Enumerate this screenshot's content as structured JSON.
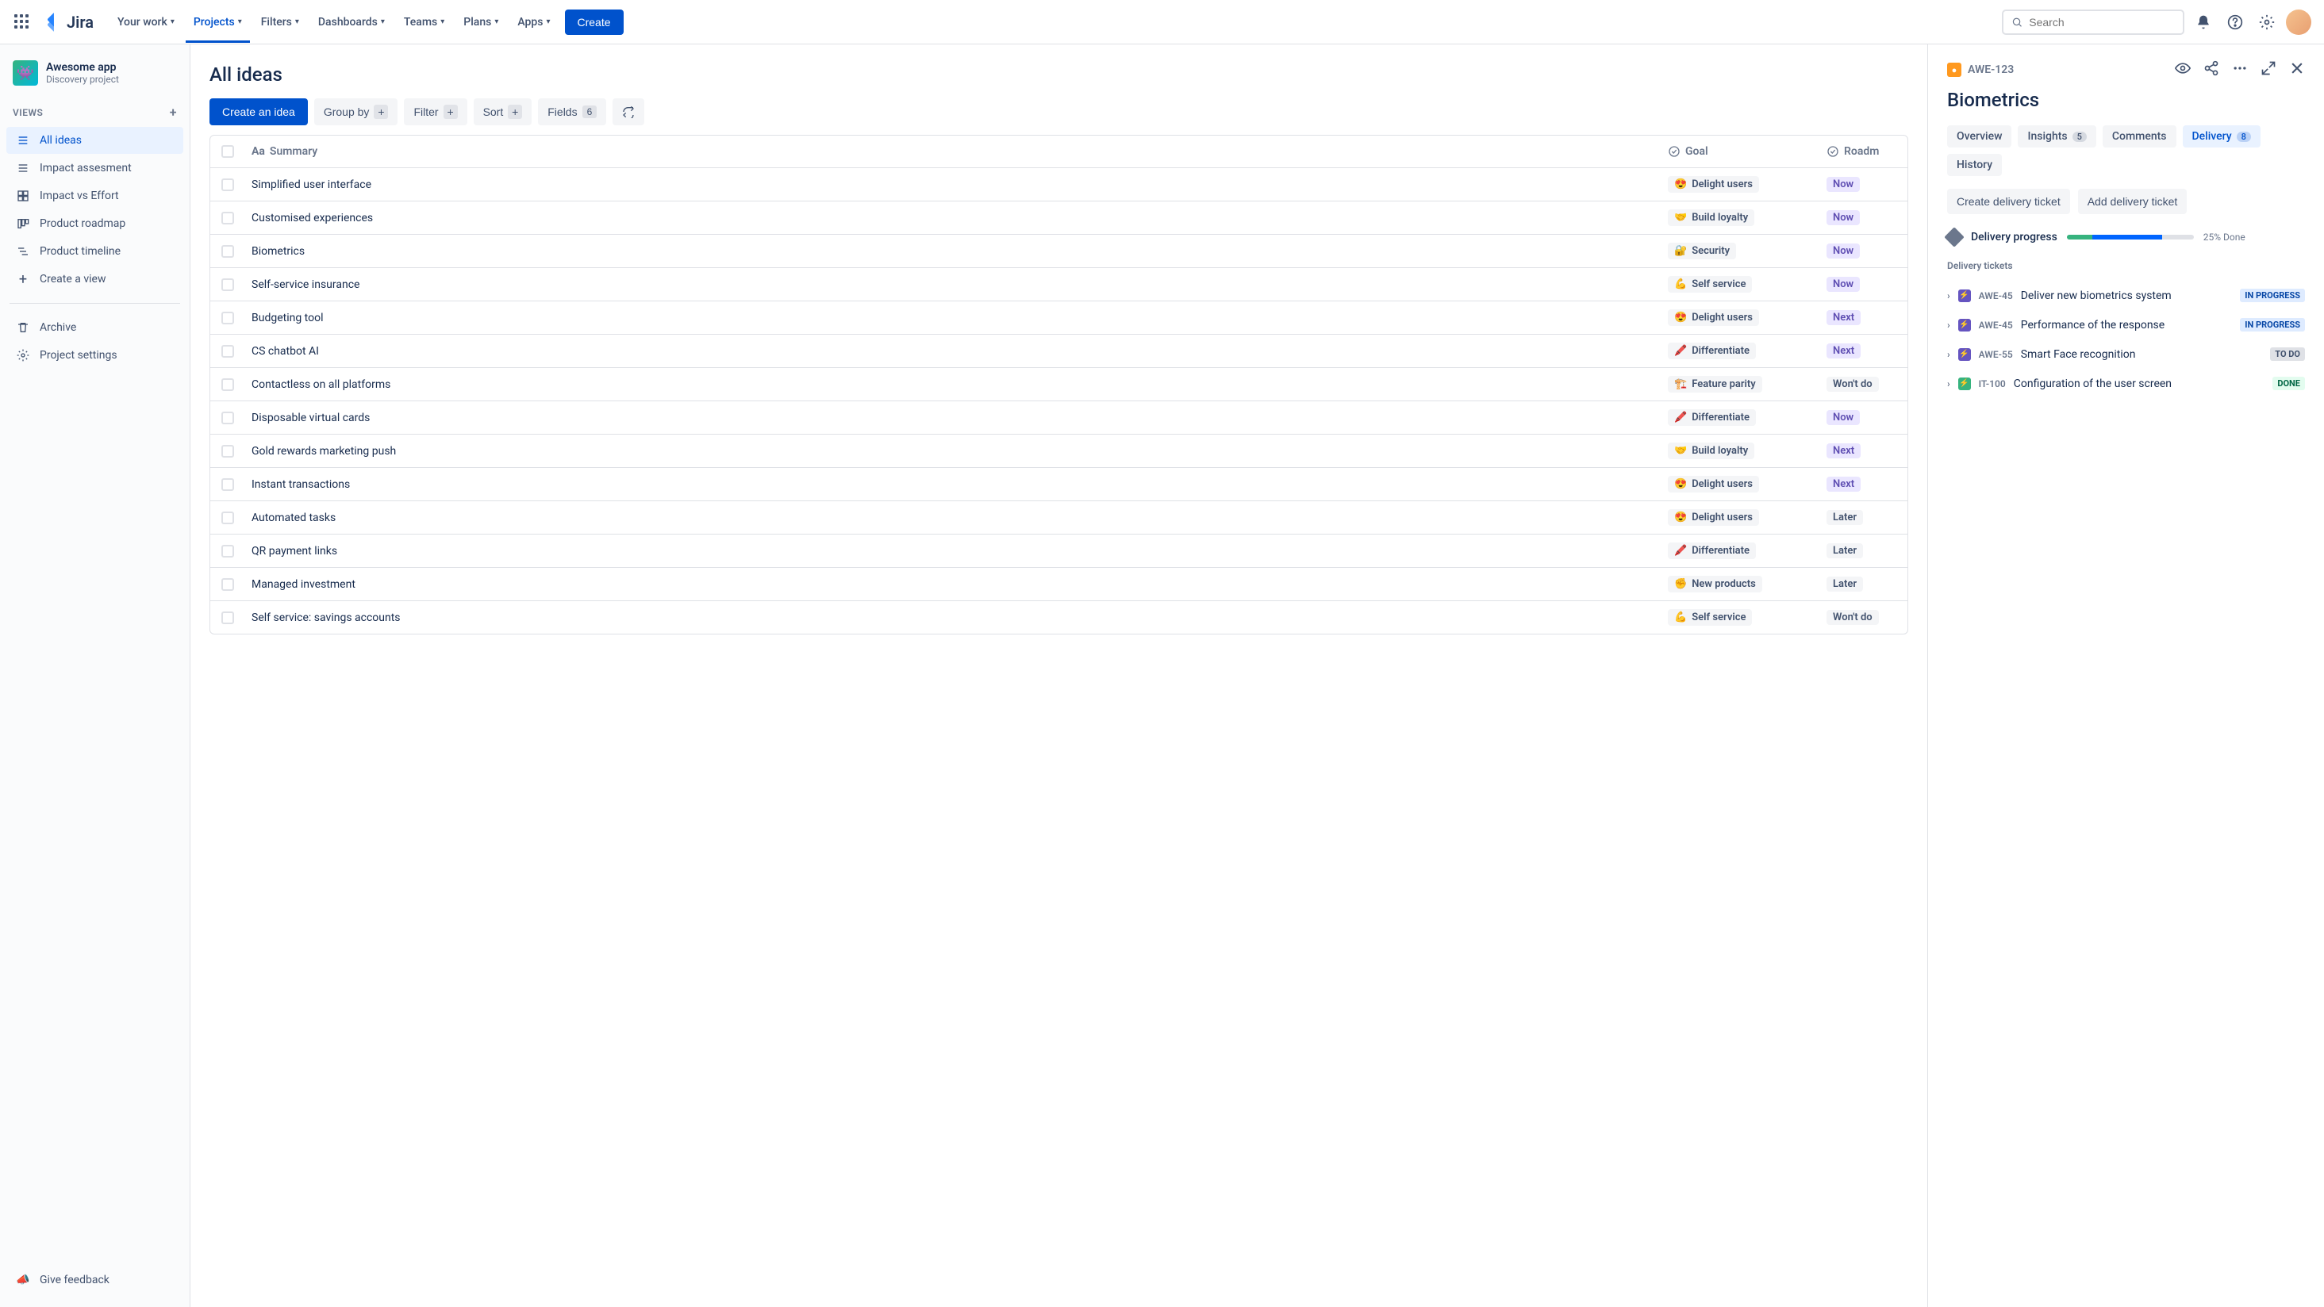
{
  "nav": {
    "logo": "Jira",
    "items": [
      "Your work",
      "Projects",
      "Filters",
      "Dashboards",
      "Teams",
      "Plans",
      "Apps"
    ],
    "activeIndex": 1,
    "createLabel": "Create",
    "searchPlaceholder": "Search"
  },
  "sidebar": {
    "project": {
      "name": "Awesome app",
      "type": "Discovery project"
    },
    "viewsHeader": "VIEWS",
    "views": [
      {
        "label": "All ideas",
        "icon": "list",
        "selected": true
      },
      {
        "label": "Impact assesment",
        "icon": "list"
      },
      {
        "label": "Impact vs Effort",
        "icon": "matrix"
      },
      {
        "label": "Product roadmap",
        "icon": "board"
      },
      {
        "label": "Product timeline",
        "icon": "timeline"
      },
      {
        "label": "Create a view",
        "icon": "plus"
      }
    ],
    "footer": [
      {
        "label": "Archive",
        "icon": "trash"
      },
      {
        "label": "Project settings",
        "icon": "gear"
      }
    ],
    "feedback": "Give feedback"
  },
  "page": {
    "title": "All ideas",
    "toolbar": {
      "create": "Create an idea",
      "groupBy": "Group by",
      "filter": "Filter",
      "sort": "Sort",
      "fields": "Fields",
      "fieldsCount": "6"
    },
    "columns": {
      "summary": "Summary",
      "goal": "Goal",
      "roadmap": "Roadm"
    },
    "rows": [
      {
        "summary": "Simplified user interface",
        "goalEmoji": "😍",
        "goal": "Delight users",
        "roadmap": "Now",
        "roadmapClass": "tag-now"
      },
      {
        "summary": "Customised experiences",
        "goalEmoji": "🤝",
        "goal": "Build loyalty",
        "roadmap": "Now",
        "roadmapClass": "tag-now"
      },
      {
        "summary": "Biometrics",
        "goalEmoji": "🔐",
        "goal": "Security",
        "roadmap": "Now",
        "roadmapClass": "tag-now"
      },
      {
        "summary": "Self-service insurance",
        "goalEmoji": "💪",
        "goal": "Self service",
        "roadmap": "Now",
        "roadmapClass": "tag-now"
      },
      {
        "summary": "Budgeting tool",
        "goalEmoji": "😍",
        "goal": "Delight users",
        "roadmap": "Next",
        "roadmapClass": "tag-next"
      },
      {
        "summary": "CS chatbot AI",
        "goalEmoji": "🖍️",
        "goal": "Differentiate",
        "roadmap": "Next",
        "roadmapClass": "tag-next"
      },
      {
        "summary": "Contactless on all platforms",
        "goalEmoji": "🏗️",
        "goal": "Feature parity",
        "roadmap": "Won't do",
        "roadmapClass": "tag-wont"
      },
      {
        "summary": "Disposable virtual cards",
        "goalEmoji": "🖍️",
        "goal": "Differentiate",
        "roadmap": "Now",
        "roadmapClass": "tag-now"
      },
      {
        "summary": "Gold rewards marketing push",
        "goalEmoji": "🤝",
        "goal": "Build loyalty",
        "roadmap": "Next",
        "roadmapClass": "tag-next"
      },
      {
        "summary": "Instant transactions",
        "goalEmoji": "😍",
        "goal": "Delight users",
        "roadmap": "Next",
        "roadmapClass": "tag-next"
      },
      {
        "summary": "Automated tasks",
        "goalEmoji": "😍",
        "goal": "Delight users",
        "roadmap": "Later",
        "roadmapClass": "tag-later"
      },
      {
        "summary": "QR payment links",
        "goalEmoji": "🖍️",
        "goal": "Differentiate",
        "roadmap": "Later",
        "roadmapClass": "tag-later"
      },
      {
        "summary": "Managed investment",
        "goalEmoji": "✊",
        "goal": "New products",
        "roadmap": "Later",
        "roadmapClass": "tag-later"
      },
      {
        "summary": "Self service: savings accounts",
        "goalEmoji": "💪",
        "goal": "Self service",
        "roadmap": "Won't do",
        "roadmapClass": "tag-wont"
      }
    ]
  },
  "detail": {
    "key": "AWE-123",
    "title": "Biometrics",
    "tabs": [
      {
        "label": "Overview"
      },
      {
        "label": "Insights",
        "count": "5"
      },
      {
        "label": "Comments"
      },
      {
        "label": "Delivery",
        "count": "8",
        "active": true
      },
      {
        "label": "History"
      }
    ],
    "actions": {
      "createTicket": "Create delivery ticket",
      "addTicket": "Add delivery ticket"
    },
    "progress": {
      "label": "Delivery progress",
      "text": "25% Done"
    },
    "ticketsHeader": "Delivery tickets",
    "tickets": [
      {
        "iconClass": "icon-purple",
        "key": "AWE-45",
        "title": "Deliver new biometrics system",
        "status": "IN PROGRESS",
        "statusClass": "st-inprogress"
      },
      {
        "iconClass": "icon-purple",
        "key": "AWE-45",
        "title": "Performance of the response",
        "status": "IN PROGRESS",
        "statusClass": "st-inprogress"
      },
      {
        "iconClass": "icon-purple",
        "key": "AWE-55",
        "title": "Smart Face recognition",
        "status": "TO DO",
        "statusClass": "st-todo"
      },
      {
        "iconClass": "icon-green",
        "key": "IT-100",
        "title": "Configuration of the user screen",
        "status": "DONE",
        "statusClass": "st-done"
      }
    ]
  }
}
